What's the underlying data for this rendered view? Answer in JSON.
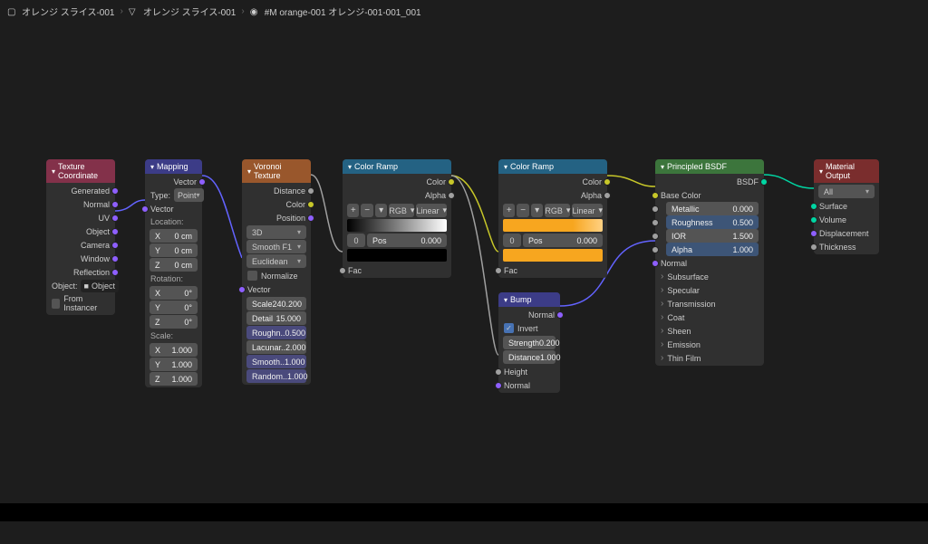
{
  "breadcrumb": {
    "a": "オレンジ スライス-001",
    "b": "オレンジ スライス-001",
    "c": "#M orange-001 オレンジ-001-001_001"
  },
  "texcoord": {
    "title": "Texture Coordinate",
    "generated": "Generated",
    "normal": "Normal",
    "uv": "UV",
    "object": "Object",
    "camera": "Camera",
    "window": "Window",
    "reflection": "Reflection",
    "obj_label": "Object:",
    "obj_val": "Object",
    "instancer": "From Instancer"
  },
  "mapping": {
    "title": "Mapping",
    "vector_out": "Vector",
    "type_k": "Type:",
    "type_v": "Point",
    "vector_in": "Vector",
    "location": "Location:",
    "rotation": "Rotation:",
    "scale": "Scale:",
    "lx": "X",
    "lxv": "0 cm",
    "ly": "Y",
    "lyv": "0 cm",
    "lz": "Z",
    "lzv": "0 cm",
    "rx": "X",
    "rxv": "0°",
    "ry": "Y",
    "ryv": "0°",
    "rz": "Z",
    "rzv": "0°",
    "sx": "X",
    "sxv": "1.000",
    "sy": "Y",
    "syv": "1.000",
    "sz": "Z",
    "szv": "1.000"
  },
  "voronoi": {
    "title": "Voronoi Texture",
    "distance": "Distance",
    "color": "Color",
    "position": "Position",
    "dim": "3D",
    "feat": "Smooth F1",
    "metric": "Euclidean",
    "normalize": "Normalize",
    "vector": "Vector",
    "scale_k": "Scale",
    "scale_v": "240.200",
    "detail_k": "Detail",
    "detail_v": "15.000",
    "rough_k": "Roughn..",
    "rough_v": "0.500",
    "lac_k": "Lacunar..",
    "lac_v": "2.000",
    "smooth_k": "Smooth..",
    "smooth_v": "1.000",
    "rand_k": "Random..",
    "rand_v": "1.000"
  },
  "ramp1": {
    "title": "Color Ramp",
    "color": "Color",
    "alpha": "Alpha",
    "rgb": "RGB",
    "linear": "Linear",
    "idx": "0",
    "pos_k": "Pos",
    "pos_v": "0.000",
    "fac": "Fac"
  },
  "ramp2": {
    "title": "Color Ramp",
    "color": "Color",
    "alpha": "Alpha",
    "rgb": "RGB",
    "linear": "Linear",
    "idx": "0",
    "pos_k": "Pos",
    "pos_v": "0.000",
    "fac": "Fac"
  },
  "bump": {
    "title": "Bump",
    "normal_out": "Normal",
    "invert": "Invert",
    "strength_k": "Strength",
    "strength_v": "0.200",
    "distance_k": "Distance",
    "distance_v": "1.000",
    "height": "Height",
    "normal_in": "Normal"
  },
  "bsdf": {
    "title": "Principled BSDF",
    "bsdf_out": "BSDF",
    "basecolor": "Base Color",
    "metallic_k": "Metallic",
    "metallic_v": "0.000",
    "roughness_k": "Roughness",
    "roughness_v": "0.500",
    "ior_k": "IOR",
    "ior_v": "1.500",
    "alpha_k": "Alpha",
    "alpha_v": "1.000",
    "normal": "Normal",
    "subsurface": "Subsurface",
    "specular": "Specular",
    "transmission": "Transmission",
    "coat": "Coat",
    "sheen": "Sheen",
    "emission": "Emission",
    "thinfilm": "Thin Film"
  },
  "output": {
    "title": "Material Output",
    "target": "All",
    "surface": "Surface",
    "volume": "Volume",
    "displacement": "Displacement",
    "thickness": "Thickness"
  }
}
